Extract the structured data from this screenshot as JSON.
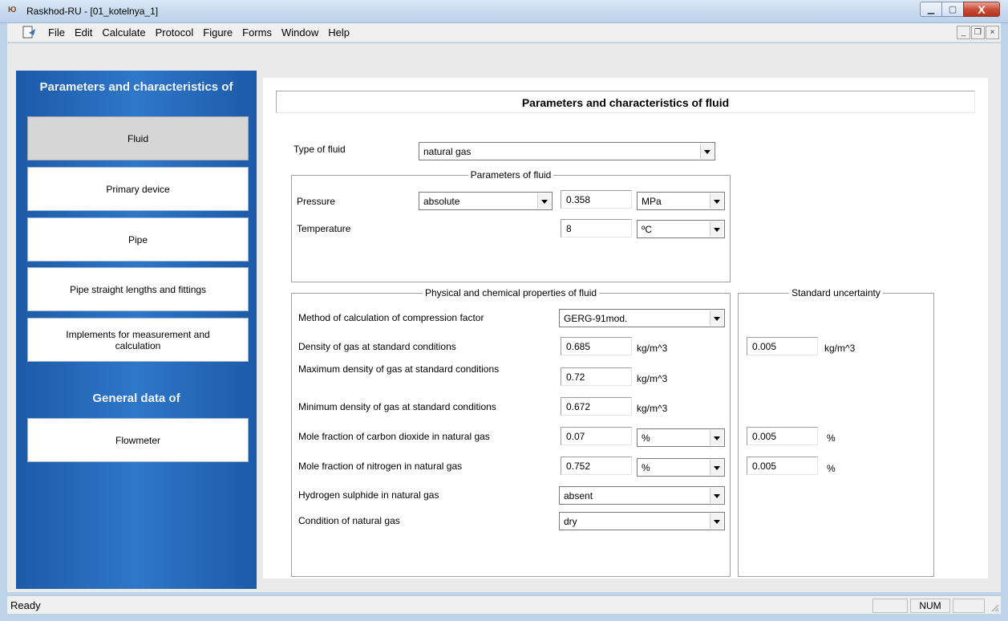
{
  "window": {
    "app_icon": "Ю",
    "title": "Raskhod-RU - [01_kotelnya_1]",
    "minimize": "▁",
    "maximize": "▢",
    "close": "X"
  },
  "menu": {
    "items": [
      "File",
      "Edit",
      "Calculate",
      "Protocol",
      "Figure",
      "Forms",
      "Window",
      "Help"
    ],
    "mdi_min": "_",
    "mdi_restore": "❐",
    "mdi_close": "×"
  },
  "sidebar": {
    "heading1": "Parameters and characteristics of",
    "buttons": [
      "Fluid",
      "Primary device",
      "Pipe",
      "Pipe straight lengths and fittings",
      "Implements for measurement and calculation"
    ],
    "heading2": "General data of",
    "button_flowmeter": "Flowmeter",
    "active": "Fluid"
  },
  "content": {
    "title": "Parameters and characteristics of fluid",
    "type_of_fluid": {
      "label": "Type of fluid",
      "value": "natural gas"
    },
    "params_group": {
      "title": "Parameters of fluid",
      "pressure": {
        "label": "Pressure",
        "kind": "absolute",
        "value": "0.358",
        "unit": "MPa"
      },
      "temperature": {
        "label": "Temperature",
        "value": "8",
        "unit": "ºC"
      }
    },
    "props_group": {
      "title": "Physical and chemical properties of fluid",
      "method": {
        "label": "Method of calculation of compression factor",
        "value": "GERG-91mod."
      },
      "density": {
        "label": "Density of gas at standard conditions",
        "value": "0.685",
        "unit": "kg/m^3"
      },
      "max_density": {
        "label": "Maximum density of gas at standard conditions",
        "value": "0.72",
        "unit": "kg/m^3"
      },
      "min_density": {
        "label": "Minimum density of gas at standard conditions",
        "value": "0.672",
        "unit": "kg/m^3"
      },
      "co2": {
        "label": "Mole fraction of carbon dioxide in natural gas",
        "value": "0.07",
        "unit": "%"
      },
      "n2": {
        "label": "Mole fraction of nitrogen in natural gas",
        "value": "0.752",
        "unit": "%"
      },
      "h2s": {
        "label": "Hydrogen sulphide in natural gas",
        "value": "absent"
      },
      "condition": {
        "label": "Condition of natural gas",
        "value": "dry"
      }
    },
    "uncertainty_group": {
      "title": "Standard uncertainty",
      "density": {
        "value": "0.005",
        "unit": "kg/m^3"
      },
      "co2": {
        "value": "0.005",
        "unit": "%"
      },
      "n2": {
        "value": "0.005",
        "unit": "%"
      }
    }
  },
  "status": {
    "text": "Ready",
    "num": "NUM"
  }
}
